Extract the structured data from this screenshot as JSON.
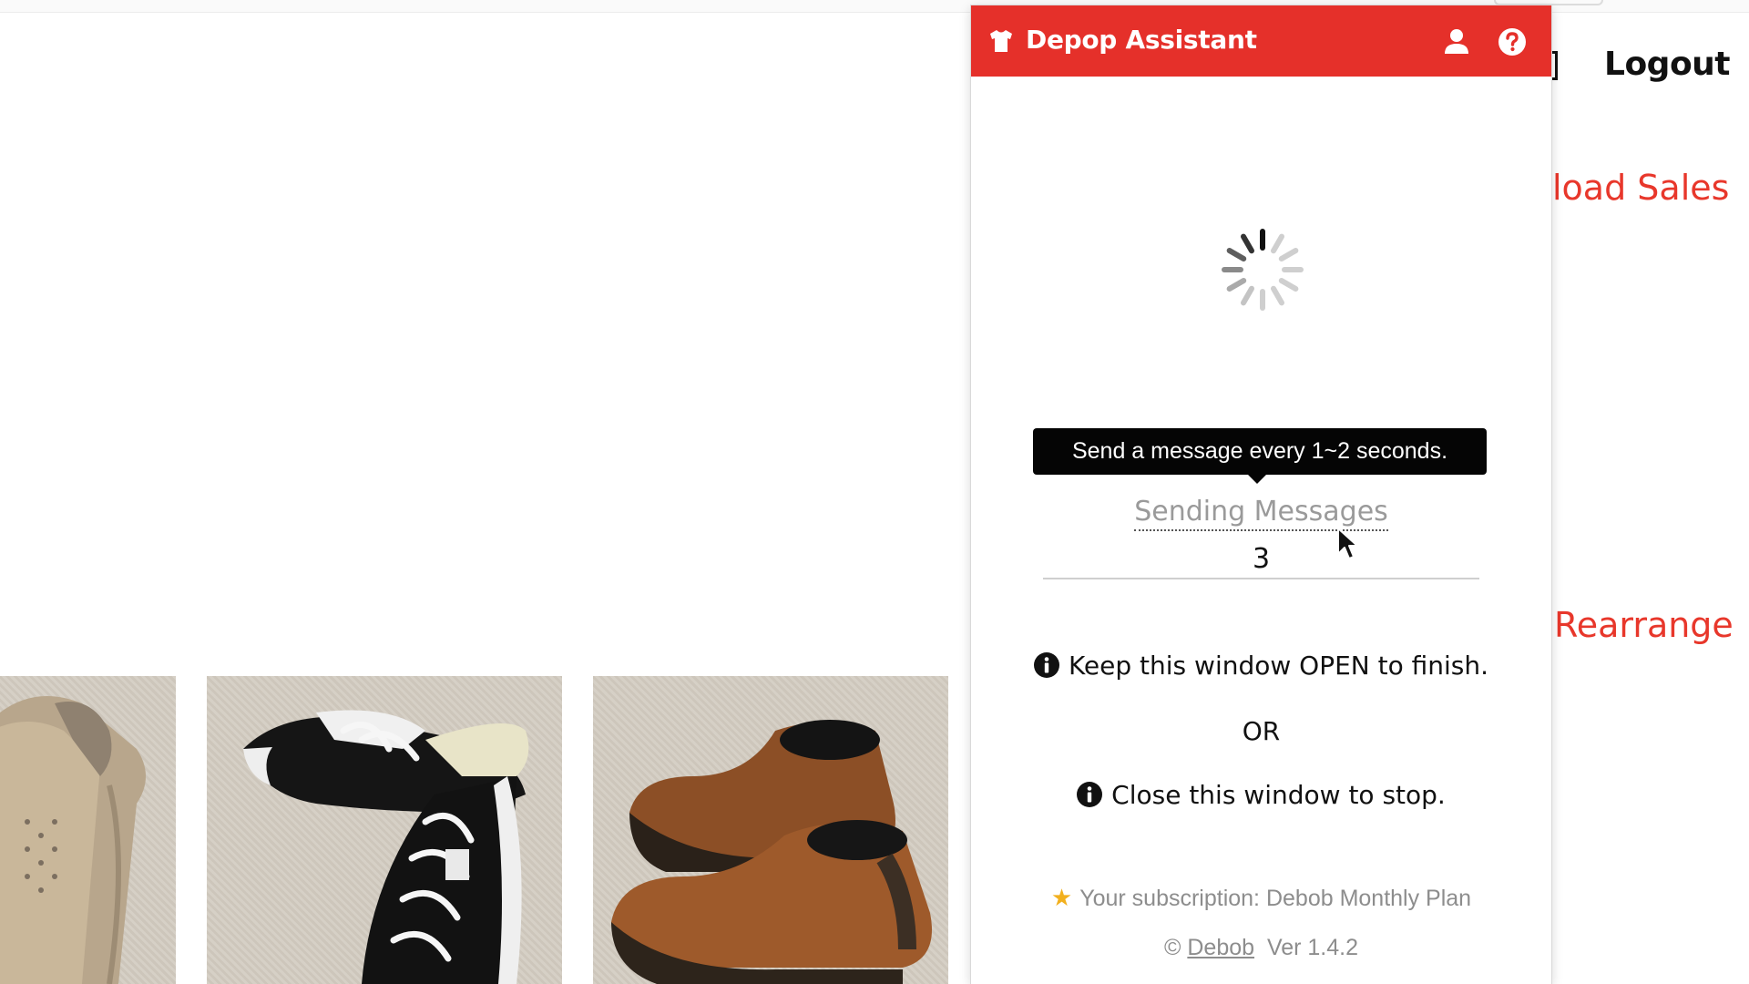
{
  "page": {
    "logout_label": "Logout",
    "load_sales_label": "load Sales",
    "rearrange_label": "Rearrange",
    "products": [
      {
        "image": "canvas-slip-on-shoe"
      },
      {
        "image": "black-converse-sneakers"
      },
      {
        "image": "brown-leather-chelsea-boots"
      }
    ]
  },
  "popup": {
    "title": "Depop Assistant",
    "icons": {
      "brand": "shirt-icon",
      "account": "user-icon",
      "help": "help-circle-icon"
    },
    "colors": {
      "header": "#e5302a",
      "tooltip": "#050505",
      "muted_text": "#8d8d8d",
      "star": "#f2b01e"
    },
    "tooltip_text": "Send a message every 1~2 seconds.",
    "status_label": "Sending Messages",
    "status_count": "3",
    "keep_open_text": "Keep this window OPEN to finish.",
    "or_text": "OR",
    "close_text": "Close this window to stop.",
    "subscription_text": "Your subscription: Debob Monthly Plan",
    "copyright_symbol": "©",
    "brand_link": "Debob",
    "version": "Ver 1.4.2"
  }
}
